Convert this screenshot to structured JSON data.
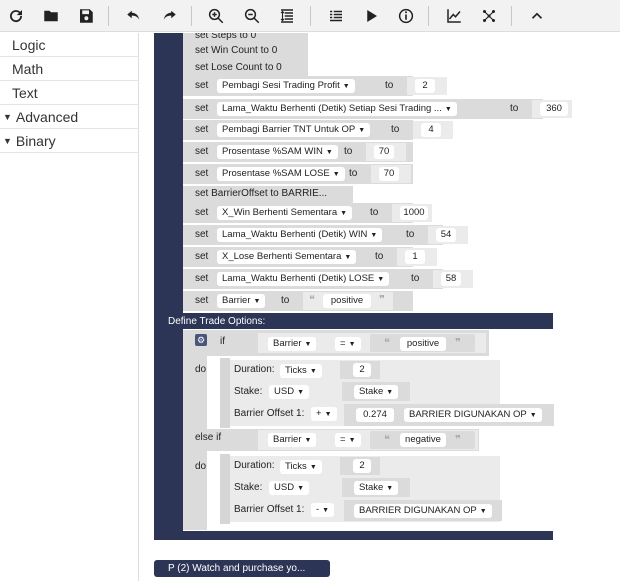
{
  "sidebar": {
    "items": [
      "Logic",
      "Math",
      "Text",
      "Advanced",
      "Binary"
    ]
  },
  "toolbar": {
    "icons": [
      "reload-icon",
      "folder-open-icon",
      "save-icon",
      "undo-icon",
      "redo-icon",
      "zoom-in-icon",
      "zoom-out-icon",
      "sort-blocks-icon",
      "list-icon",
      "play-icon",
      "info-icon",
      "chart-icon",
      "tradingview-icon",
      "collapse-icon"
    ]
  },
  "workspace": {
    "set_kw": "set",
    "to_kw": "to",
    "rows": [
      {
        "text": "set Steps to 0"
      },
      {
        "text": "set Win Count to 0"
      },
      {
        "text": "set Lose Count to 0"
      },
      {
        "var": "Pembagi Sesi Trading Profit",
        "val": "2"
      },
      {
        "var": "Lama_Waktu Berhenti (Detik) Setiap Sesi Trading ...",
        "val": "360"
      },
      {
        "var": "Pembagi Barrier TNT Untuk OP",
        "val": "4"
      },
      {
        "var": "Prosentase %SAM WIN",
        "val": "70"
      },
      {
        "var": "Prosentase %SAM LOSE",
        "val": "70"
      },
      {
        "text": "set BarrierOffset to BARRIE..."
      },
      {
        "var": "X_Win Berhenti Sementara",
        "val": "1000"
      },
      {
        "var": "Lama_Waktu Berhenti (Detik) WIN",
        "val": "54"
      },
      {
        "var": "X_Lose Berhenti Sementara",
        "val": "1"
      },
      {
        "var": "Lama_Waktu Berhenti (Detik) LOSE",
        "val": "58"
      },
      {
        "var": "Barrier",
        "val": "positive",
        "str": true
      }
    ],
    "define_trade_label": "Define Trade Options:",
    "if_kw": "if",
    "do_kw": "do",
    "elseif_kw": "else if",
    "if1": {
      "var": "Barrier",
      "op": "=",
      "str": "positive"
    },
    "do1": {
      "duration_label": "Duration:",
      "duration_unit": "Ticks",
      "duration_val": "2",
      "stake_label": "Stake:",
      "currency": "USD",
      "stake_var": "Stake",
      "offset_label": "Barrier Offset 1:",
      "sign": "+",
      "offset_val": "0.274",
      "offset_var": "BARRIER DIGUNAKAN OP"
    },
    "if2": {
      "var": "Barrier",
      "op": "=",
      "str": "negative"
    },
    "do2": {
      "duration_label": "Duration:",
      "duration_unit": "Ticks",
      "duration_val": "2",
      "stake_label": "Stake:",
      "currency": "USD",
      "stake_var": "Stake",
      "offset_label": "Barrier Offset 1:",
      "sign": "-",
      "offset_var": "BARRIER DIGUNAKAN OP"
    },
    "purchase_block": "P (2) Watch and purchase yo..."
  },
  "colors": {
    "navy": "#2c3556",
    "block_grey": "#dbdbdb",
    "toolbar_bg": "#f2f2f2"
  }
}
